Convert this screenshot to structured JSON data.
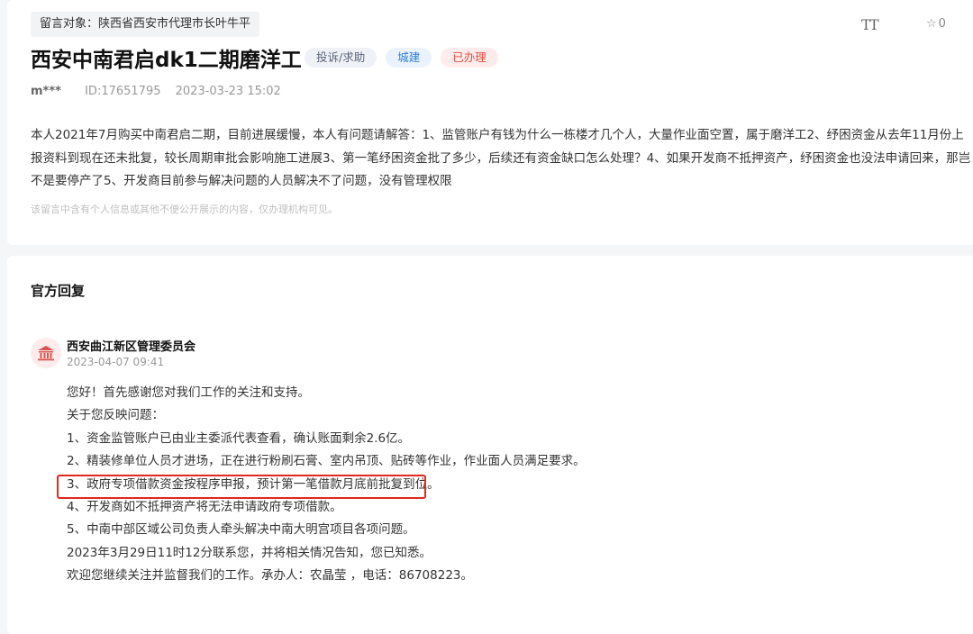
{
  "message": {
    "target": "留言对象：陕西省西安市代理市长叶牛平",
    "title": "西安中南君启dk1二期磨洋工",
    "tags": {
      "category": "投诉/求助",
      "area": "城建",
      "status": "已办理"
    },
    "user": "m***",
    "id": "ID:17651795",
    "time": "2023-03-23 15:02",
    "content": "本人2021年7月购买中南君启二期，目前进展缓慢，本人有问题请解答：1、监管账户有钱为什么一栋楼才几个人，大量作业面空置，属于磨洋工2、纾困资金从去年11月份上报资料到现在还未批复，较长周期审批会影响施工进展3、第一笔纾困资金批了多少，后续还有资金缺口怎么处理？4、如果开发商不抵押资产，纾困资金也没法申请回来，那岂不是要停产了5、开发商目前参与解决问题的人员解决不了问题，没有管理权限",
    "privacy_note": "该留言中含有个人信息或其他不便公开展示的内容，仅办理机构可见。"
  },
  "toolbar": {
    "font_icon_label": "TT",
    "star_count": "0"
  },
  "reply": {
    "section_title": "官方回复",
    "org_name": "西安曲江新区管理委员会",
    "time": "2023-04-07 09:41",
    "lines": [
      "您好！首先感谢您对我们工作的关注和支持。",
      "关于您反映问题：",
      "1、资金监管账户已由业主委派代表查看，确认账面剩余2.6亿。",
      "2、精装修单位人员才进场，正在进行粉刷石膏、室内吊顶、贴砖等作业，作业面人员满足要求。",
      "3、政府专项借款资金按程序申报，预计第一笔借款月底前批复到位。",
      "4、开发商如不抵押资产将无法申请政府专项借款。",
      "5、中南中部区域公司负责人牵头解决中南大明宫项目各项问题。",
      "2023年3月29日11时12分联系您，并将相关情况告知，您已知悉。",
      "欢迎您继续关注并监督我们的工作。承办人：农晶莹 ，电话：86708223。"
    ]
  },
  "colors": {
    "highlight_border": "#e0281f",
    "status_tag": "#e04e45",
    "area_tag": "#2f7fd8"
  },
  "icons": {
    "font_size": "font-size-icon",
    "favorite": "star-icon",
    "org_avatar": "government-building-icon"
  }
}
